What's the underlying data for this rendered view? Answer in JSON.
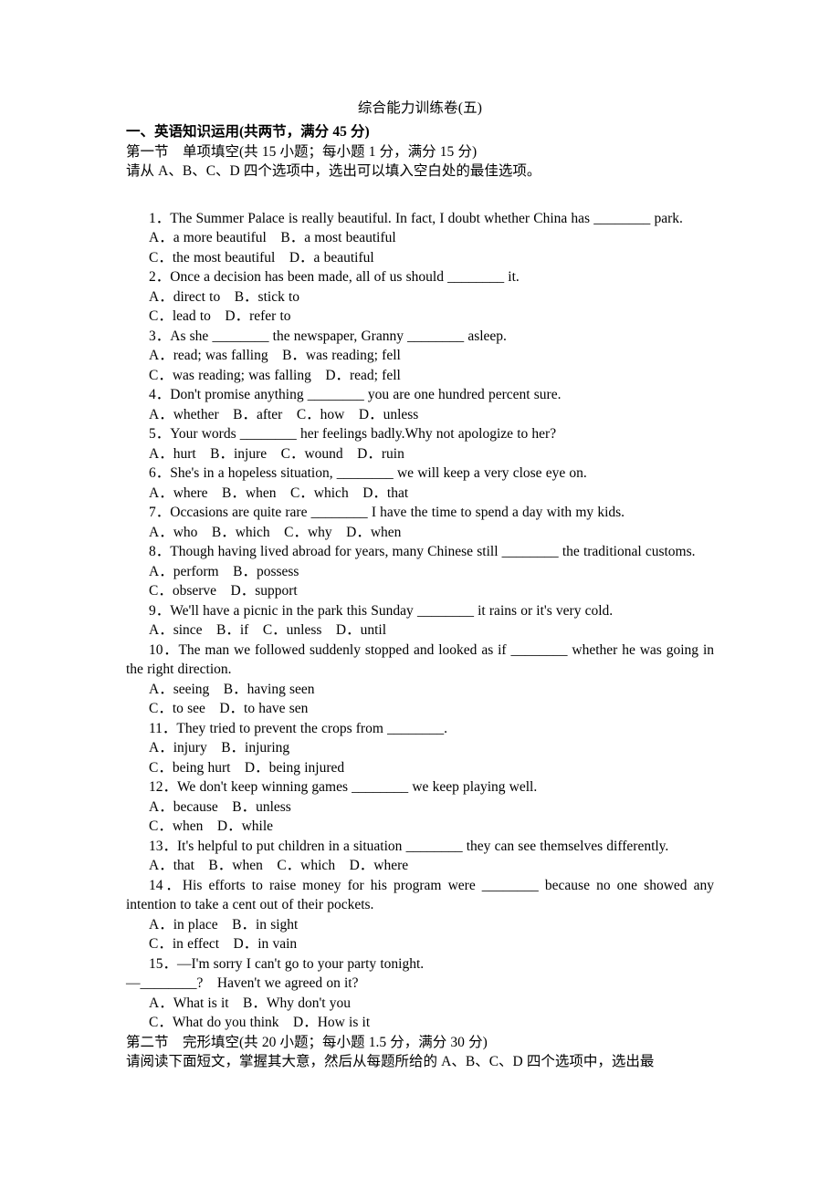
{
  "document": {
    "title": "综合能力训练卷(五)",
    "section_heading": "一、英语知识运用(共两节，满分 45 分)",
    "part_one_heading": "第一节　单项填空(共 15 小题；每小题 1 分，满分 15 分)",
    "part_one_instruction": "请从 A、B、C、D 四个选项中，选出可以填入空白处的最佳选项。",
    "part_two_heading": "第二节　完形填空(共 20 小题；每小题 1.5 分，满分 30 分)",
    "part_two_instruction": "请阅读下面短文，掌握其大意，然后从每题所给的 A、B、C、D 四个选项中，选出最"
  },
  "questions": [
    {
      "stem": "1．The Summer Palace is really beautiful. In fact, I doubt whether China has ________ park.",
      "options_line1": "A．a more beautiful　B．a most beautiful",
      "options_line2": "C．the most beautiful　D．a beautiful"
    },
    {
      "stem": "2．Once a decision has been made, all of us should ________ it.",
      "options_line1": "A．direct to　B．stick to",
      "options_line2": "C．lead to　D．refer to"
    },
    {
      "stem": "3．As she ________ the newspaper, Granny ________ asleep.",
      "options_line1": "A．read; was falling　B．was reading; fell",
      "options_line2": "C．was reading; was falling　D．read; fell"
    },
    {
      "stem": "4．Don't promise anything ________ you are one hundred percent sure.",
      "options_line1": "A．whether　B．after　C．how　D．unless",
      "options_line2": ""
    },
    {
      "stem": "5．Your words ________ her feelings badly.Why not apologize to her?",
      "options_line1": "A．hurt　B．injure　C．wound　D．ruin",
      "options_line2": ""
    },
    {
      "stem": "6．She's in a hopeless situation, ________ we will keep a very close eye on.",
      "options_line1": "A．where　B．when　C．which　D．that",
      "options_line2": ""
    },
    {
      "stem": "7．Occasions are quite rare ________ I have the time to spend a day with my kids.",
      "options_line1": "A．who　B．which　C．why　D．when",
      "options_line2": ""
    },
    {
      "stem": "8．Though having lived abroad for years, many Chinese still ________ the traditional customs.",
      "options_line1": "A．perform　B．possess",
      "options_line2": "C．observe　D．support",
      "justified": true
    },
    {
      "stem": "9．We'll have a picnic in the park this Sunday ________ it rains or it's very cold.",
      "options_line1": "A．since　B．if　C．unless　D．until",
      "options_line2": ""
    },
    {
      "stem": "10．The man we followed suddenly stopped and looked as if ________ whether he was going in the right direction.",
      "options_line1": "A．seeing　B．having seen",
      "options_line2": "C．to see　D．to have sen"
    },
    {
      "stem": "11．They tried to prevent the crops from ________.",
      "options_line1": "A．injury　B．injuring",
      "options_line2": "C．being hurt　D．being injured"
    },
    {
      "stem": "12．We don't keep winning games ________ we keep playing well.",
      "options_line1": "A．because　B．unless",
      "options_line2": "C．when　D．while"
    },
    {
      "stem": "13．It's helpful to put children in a situation ________ they can see themselves differently.",
      "options_line1": "A．that　B．when　C．which　D．where",
      "options_line2": ""
    },
    {
      "stem": "14．His efforts to raise money for his program were ________ because no one showed any intention to take a cent out of their pockets.",
      "options_line1": "A．in place　B．in sight",
      "options_line2": "C．in effect　D．in vain",
      "justified": true
    },
    {
      "stem": "15．—I'm sorry I can't go to your party tonight.",
      "stem_line2": "—________?　Haven't we agreed on it?",
      "options_line1": "A．What is it　B．Why don't you",
      "options_line2": "C．What do you think　D．How is it"
    }
  ]
}
